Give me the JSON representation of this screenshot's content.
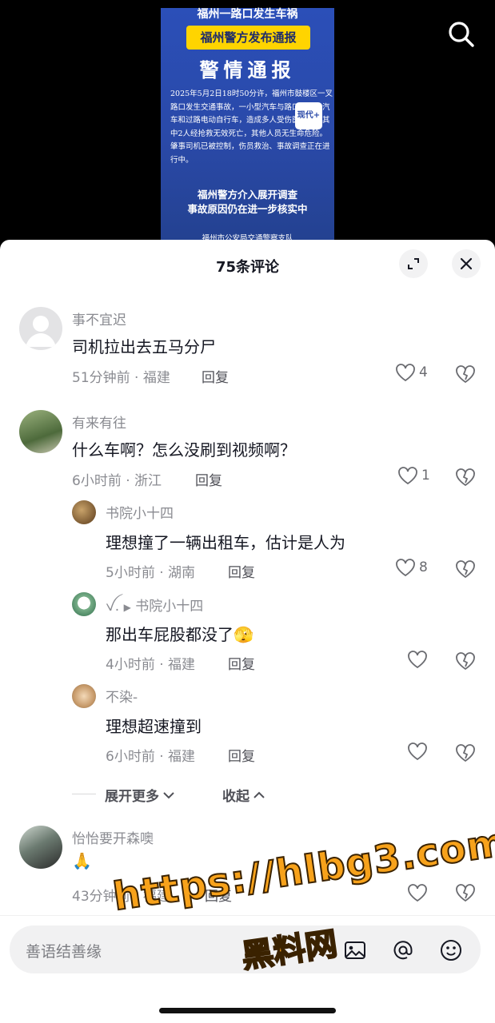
{
  "video": {
    "poster": {
      "headline_top": "福州一路口发生车祸",
      "badge": "福州警方发布通报",
      "title": "警情通报",
      "body": "2025年5月2日18时50分许，福州市鼓楼区一叉路口发生交通事故，一小型汽车与路口上前方汽车和过路电动自行车，造成多人受伤医救治，其中2人经抢救无效死亡，其他人员无生命危险。肇事司机已被控制，伤员救治、事故调查正在进行中。",
      "sticker": "现代+",
      "sub_head_1": "福州警方介入展开调查",
      "sub_head_2": "事故原因仍在进一步核实中",
      "org": "福州市公安局交通警察支队"
    }
  },
  "sheet": {
    "title": "75条评论"
  },
  "comments": [
    {
      "user": "事不宜迟",
      "text": "司机拉出去五马分尸",
      "time": "51分钟前",
      "location": "福建",
      "reply": "回复",
      "likes": "4"
    },
    {
      "user": "有来有往",
      "text": "什么车啊？怎么没刷到视频啊？",
      "time": "6小时前",
      "location": "浙江",
      "reply": "回复",
      "likes": "1"
    },
    {
      "user": "书院小十四",
      "text": "理想撞了一辆出租车，估计是人为",
      "time": "5小时前",
      "location": "湖南",
      "reply": "回复",
      "likes": "8"
    },
    {
      "user": "ꪜ.",
      "reply_to": "书院小十四",
      "text": "那出车屁股都没了",
      "emoji": "🫣",
      "time": "4小时前",
      "location": "福建",
      "reply": "回复",
      "likes": ""
    },
    {
      "user": "不染-",
      "text": "理想超速撞到",
      "time": "6小时前",
      "location": "福建",
      "reply": "回复",
      "likes": ""
    },
    {
      "user": "怡怡要开森噢",
      "text": "🙏",
      "time": "43分钟前",
      "location": "福建",
      "reply": "回复",
      "likes": ""
    }
  ],
  "more": {
    "expand": "展开更多",
    "collapse": "收起"
  },
  "input": {
    "placeholder": "善语结善缘"
  },
  "watermark": {
    "line1": "https://hlbg3.com",
    "line2": "黑料网"
  },
  "icons": [
    "search-icon",
    "expand-icon",
    "close-icon",
    "heart-icon",
    "broken-heart-icon",
    "image-icon",
    "at-icon",
    "emoji-icon",
    "chevron-down-icon",
    "chevron-up-icon"
  ]
}
